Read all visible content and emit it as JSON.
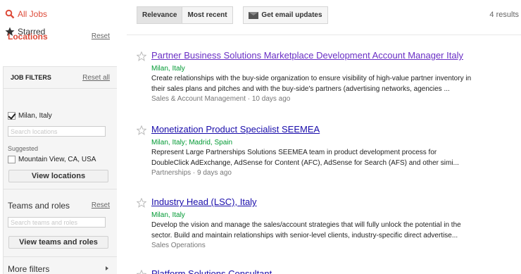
{
  "nav": {
    "all_jobs": "All Jobs",
    "starred": "Starred"
  },
  "filters": {
    "title": "JOB FILTERS",
    "reset_all": "Reset all",
    "locations": {
      "title": "Locations",
      "reset": "Reset",
      "selected": "Milan, Italy",
      "search_placeholder": "Search locations",
      "suggested_label": "Suggested",
      "suggested_item": "Mountain View, CA, USA",
      "view_button": "View locations"
    },
    "teams": {
      "title": "Teams and roles",
      "reset": "Reset",
      "search_placeholder": "Search teams and roles",
      "view_button": "View teams and roles"
    },
    "more": "More filters"
  },
  "toolbar": {
    "sort_relevance": "Relevance",
    "sort_recent": "Most recent",
    "email_updates": "Get email updates",
    "results": "4 results"
  },
  "jobs": [
    {
      "title": "Partner Business Solutions Marketplace Development Account Manager Italy",
      "location": "Milan, Italy",
      "desc1": "Create relationships with the buy-side organization to ensure visibility of high-value partner inventory in",
      "desc2": "their sales plans and pitches and with the buy-side's partners (advertising networks, agencies ...",
      "meta": "Sales & Account Management · 10 days ago"
    },
    {
      "title": "Monetization Product Specialist SEEMEA",
      "location": "Milan, Italy; Madrid, Spain",
      "desc1": "Represent Large Partnerships Solutions SEEMEA team in product development process for",
      "desc2": "DoubleClick AdExchange, AdSense for Content (AFC), AdSense for Search (AFS) and other simi...",
      "meta": "Partnerships · 9 days ago"
    },
    {
      "title": "Industry Head (LSC), Italy",
      "location": "Milan, Italy",
      "desc1": "Develop the vision and manage the sales/account strategies that will fully unlock the potential in the",
      "desc2": "sector. Build and maintain relationships with senior-level clients, industry-specific direct advertise...",
      "meta": "Sales Operations"
    },
    {
      "title": "Platform Solutions Consultant"
    }
  ]
}
